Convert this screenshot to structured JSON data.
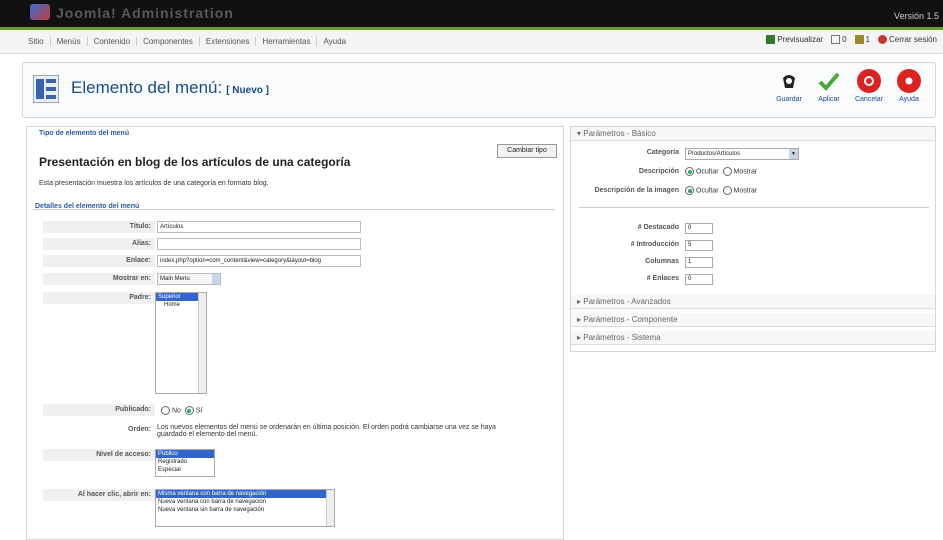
{
  "topbar": {
    "logo_text": "Joomla! Administration",
    "version": "Versión 1.5"
  },
  "menubar": {
    "items": [
      "Sitio",
      "Menús",
      "Contenido",
      "Componentes",
      "Extensiones",
      "Herramientas",
      "Ayuda"
    ],
    "preview": "Previsualizar",
    "messages": "0",
    "users": "1",
    "logout": "Cerrar sesión"
  },
  "header": {
    "title": "Elemento del menú:",
    "subtitle": "[ Nuevo ]"
  },
  "toolbar": {
    "save": "Guardar",
    "apply": "Aplicar",
    "cancel": "Cancelar",
    "help": "Ayuda"
  },
  "menu_type": {
    "legend": "Tipo de elemento del menú",
    "change_button": "Cambiar tipo",
    "title": "Presentación en blog de los artículos de una categoría",
    "description": "Esta presentación muestra los artículos de una categoría en formato blog."
  },
  "details": {
    "legend": "Detalles del elemento del menú",
    "title_label": "Título:",
    "title_value": "Artículos",
    "alias_label": "Alias:",
    "alias_value": "",
    "link_label": "Enlace:",
    "link_value": "index.php?option=com_content&view=category&layout=blog",
    "display_label": "Mostrar en:",
    "display_value": "Main Menu",
    "parent_label": "Padre:",
    "parent_options": [
      "Superior",
      "Home"
    ],
    "published_label": "Publicado:",
    "published_no": "No",
    "published_yes": "Sí",
    "order_label": "Orden:",
    "order_text_1": "Los nuevos elementos del menú se ordenarán en última posición. El orden podrá cambiarse una vez se haya",
    "order_text_2": "guardado el elemento del menú.",
    "access_label": "Nivel de acceso:",
    "access_options": [
      "Público",
      "Registrado",
      "Especial"
    ],
    "click_label": "Al hacer clic, abrir en:",
    "click_options": [
      "Misma ventana con barra de navegación",
      "Nueva ventana con barra de navegación",
      "Nueva ventana sin barra de navegación"
    ]
  },
  "params": {
    "basic_head": "Parámetros - Básico",
    "category_label": "Categoría",
    "category_value": "Productos/Artículos",
    "description_label": "Descripción",
    "desc_image_label": "Descripción de la imagen",
    "hide": "Ocultar",
    "show": "Mostrar",
    "featured_label": "# Destacado",
    "featured_value": "0",
    "intro_label": "# Introducción",
    "intro_value": "5",
    "columns_label": "Columnas",
    "columns_value": "1",
    "links_label": "# Enlaces",
    "links_value": "0",
    "advanced_head": "Parámetros - Avanzados",
    "component_head": "Parámetros - Componente",
    "system_head": "Parámetros - Sistema"
  }
}
